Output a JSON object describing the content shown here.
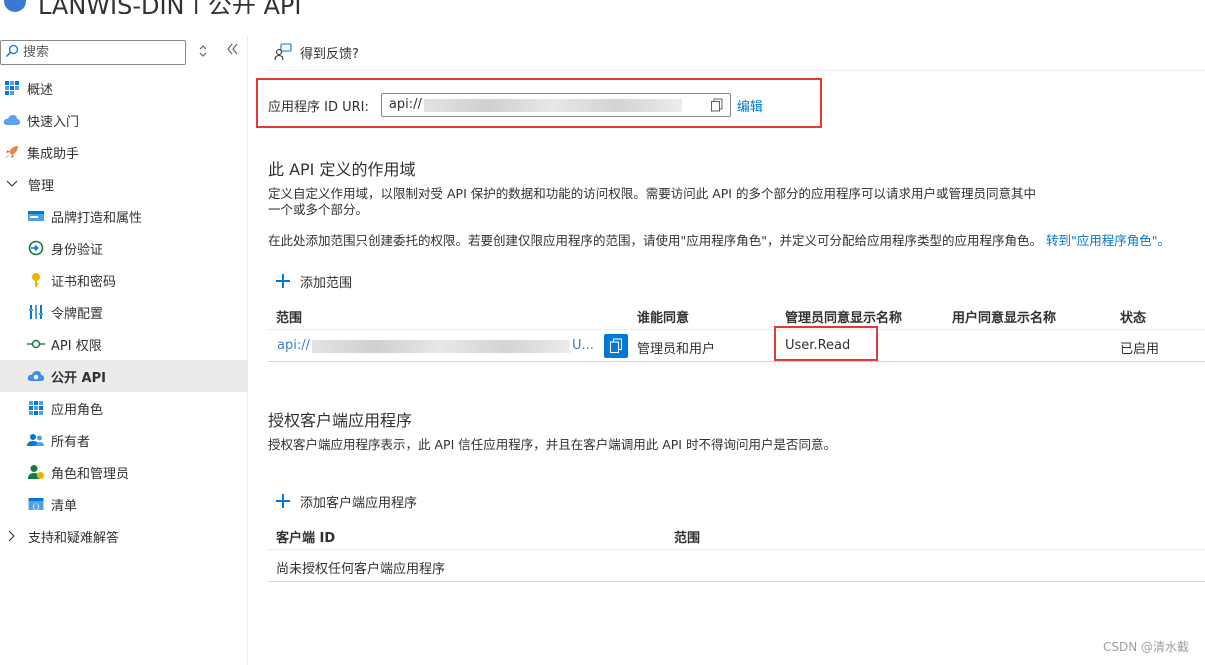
{
  "window": {
    "title": "LANWIS-DIN | 公开 API"
  },
  "sidebar": {
    "search_placeholder": "搜索",
    "items": [
      {
        "label": "概述",
        "icon": "overview-grid-icon",
        "level": 0
      },
      {
        "label": "快速入门",
        "icon": "quickstart-cloud-icon",
        "level": 0
      },
      {
        "label": "集成助手",
        "icon": "rocket-icon",
        "level": 0
      },
      {
        "label": "管理",
        "icon": "chevron-down-icon",
        "level": 0,
        "expandable": true,
        "expanded": true
      },
      {
        "label": "品牌打造和属性",
        "icon": "branding-icon",
        "level": 1
      },
      {
        "label": "身份验证",
        "icon": "authentication-icon",
        "level": 1
      },
      {
        "label": "证书和密码",
        "icon": "key-icon",
        "level": 1
      },
      {
        "label": "令牌配置",
        "icon": "token-bars-icon",
        "level": 1
      },
      {
        "label": "API 权限",
        "icon": "api-permissions-icon",
        "level": 1
      },
      {
        "label": "公开 API",
        "icon": "expose-api-cloud-icon",
        "level": 1,
        "active": true
      },
      {
        "label": "应用角色",
        "icon": "app-roles-grid-icon",
        "level": 1
      },
      {
        "label": "所有者",
        "icon": "owners-people-icon",
        "level": 1
      },
      {
        "label": "角色和管理员",
        "icon": "roles-admins-icon",
        "level": 1
      },
      {
        "label": "清单",
        "icon": "manifest-icon",
        "level": 1
      },
      {
        "label": "支持和疑难解答",
        "icon": "chevron-right-icon",
        "level": 0,
        "expandable": true,
        "expanded": false
      }
    ]
  },
  "toolbar": {
    "feedback_label": "得到反馈?"
  },
  "app_id_uri": {
    "label": "应用程序 ID URI:",
    "value_prefix": "api://",
    "edit_label": "编辑"
  },
  "scopes": {
    "title": "此 API 定义的作用域",
    "desc_line1": "定义自定义作用域，以限制对受 API 保护的数据和功能的访问权限。需要访问此 API 的多个部分的应用程序可以请求用户或管理员同意其中",
    "desc_line2": "一个或多个部分。",
    "desc2": "在此处添加范围只创建委托的权限。若要创建仅限应用程序的范围，请使用\"应用程序角色\"，并定义可分配给应用程序类型的应用程序角色。",
    "desc2_link": "转到\"应用程序角色\"。",
    "add_label": "添加范围",
    "columns": [
      "范围",
      "谁能同意",
      "管理员同意显示名称",
      "用户同意显示名称",
      "状态"
    ],
    "rows": [
      {
        "scope_prefix": "api://",
        "scope_suffix": "U...",
        "who_can_consent": "管理员和用户",
        "admin_display_name": "User.Read",
        "user_display_name": "",
        "state": "已启用"
      }
    ]
  },
  "clients": {
    "title": "授权客户端应用程序",
    "desc": "授权客户端应用程序表示，此 API 信任应用程序，并且在客户端调用此 API 时不得询问用户是否同意。",
    "add_label": "添加客户端应用程序",
    "columns": [
      "客户端 ID",
      "范围"
    ],
    "empty_text": "尚未授权任何客户端应用程序"
  },
  "watermark": "CSDN @清水截",
  "colors": {
    "accent": "#0078d4",
    "highlight": "#e53935"
  }
}
